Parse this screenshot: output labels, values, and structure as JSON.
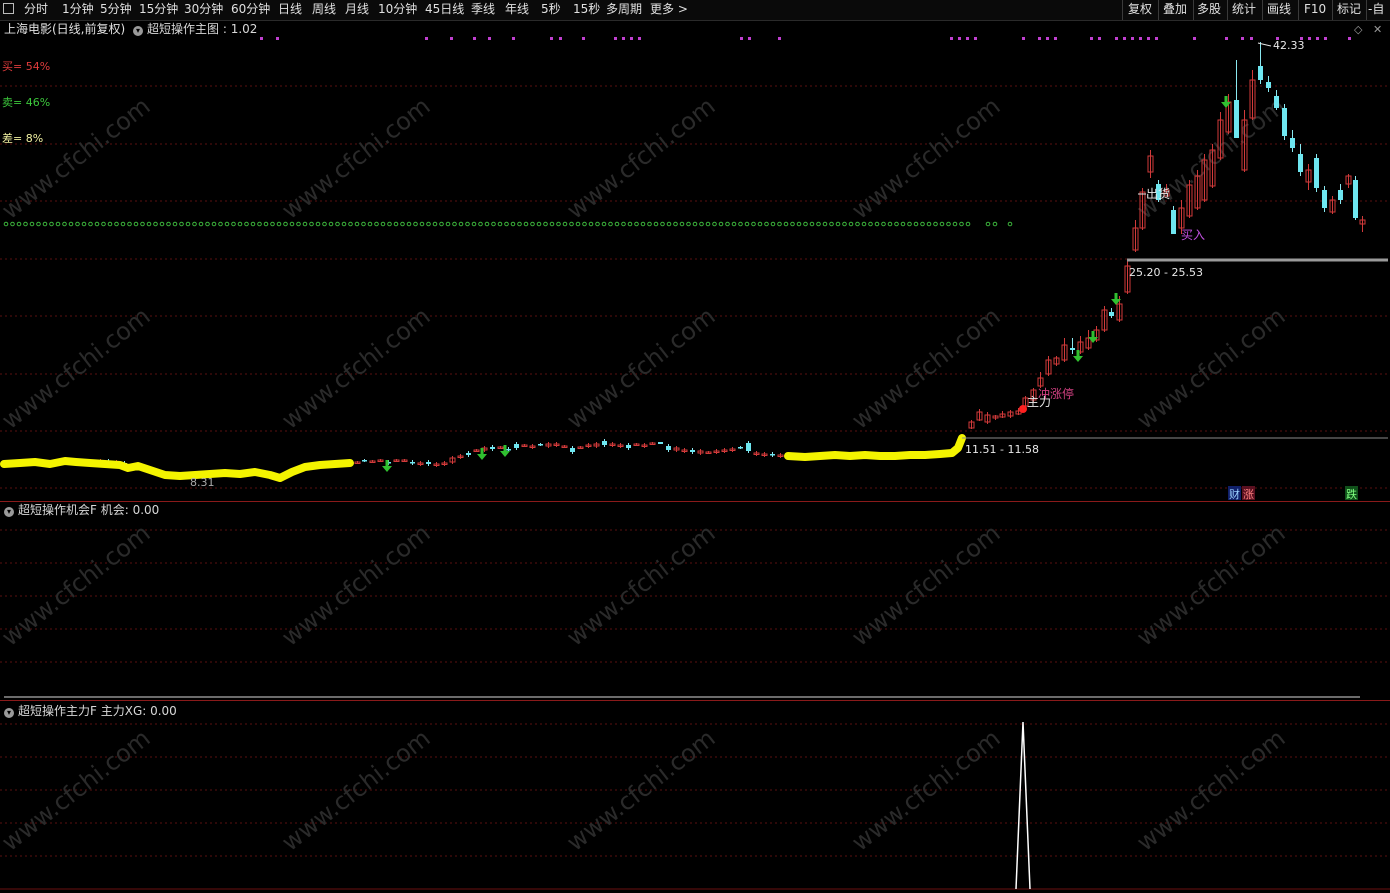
{
  "toolbar": {
    "tabs": [
      "分时",
      "1分钟",
      "5分钟",
      "15分钟",
      "30分钟",
      "60分钟",
      "日线",
      "周线",
      "月线",
      "10分钟",
      "45日线",
      "季线",
      "年线",
      "5秒",
      "15秒",
      "多周期",
      "更多 >"
    ],
    "right_tabs": [
      "复权",
      "叠加",
      "多股",
      "统计",
      "画线",
      "F10",
      "标记",
      "-自"
    ]
  },
  "main_panel": {
    "title": "上海电影(日线,前复权)",
    "indicator_title": "超短操作主图 : 1.02",
    "buy_label": "买= 54%",
    "sell_label": "卖= 46%",
    "diff_label": "差= 8%",
    "high_label": "42.33",
    "range_top_label": "25.20 - 25.53",
    "range_bottom_label": "11.51 - 11.58",
    "low_label": "8.31",
    "sell_signal_text": "出货",
    "buy_signal_text": "买入",
    "launch_text": "主力",
    "limit_up_text": "冲涨停",
    "badges": [
      "财",
      "涨",
      "跌"
    ]
  },
  "sub_panel_1": {
    "title": "超短操作机会F  机会: 0.00"
  },
  "sub_panel_2": {
    "title": "超短操作主力F  主力XG: 0.00"
  },
  "watermark": "www.cfchi.com",
  "colors": {
    "background": "#000000",
    "up": "#d23a3a",
    "down": "#6ee6f0",
    "yellow_band": "#f4f400",
    "green_dots": "#3cb43c",
    "magenta_dots": "#c040d0",
    "grid": "#5a1010",
    "buy_label": "#e03c3c",
    "sell_label": "#3cc83c"
  }
}
